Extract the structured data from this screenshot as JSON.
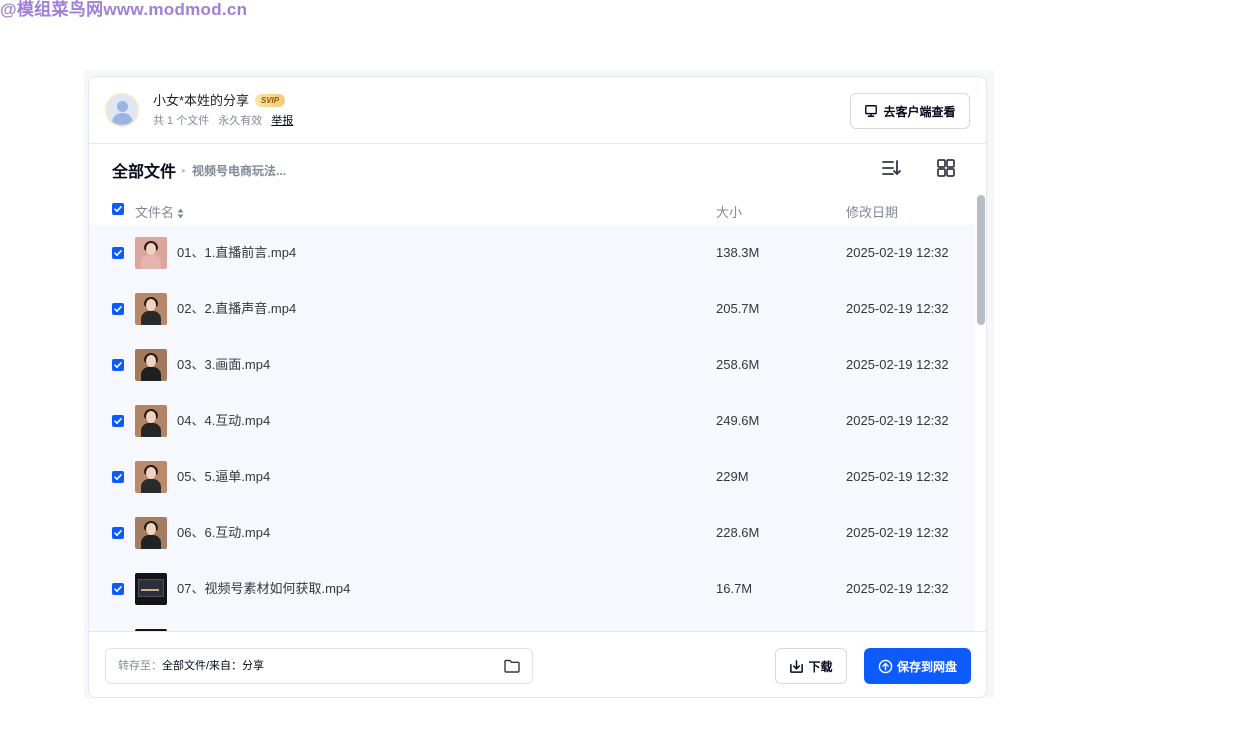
{
  "watermark": "@模组菜鸟网www.modmod.cn",
  "header": {
    "share_title": "小女*本姓的分享",
    "badge": "SVIP",
    "file_count": "共 1 个文件",
    "validity": "永久有效",
    "report": "举报",
    "client_button": "去客户端查看"
  },
  "breadcrumb": {
    "root": "全部文件",
    "separator": "▸",
    "current": "视频号电商玩法..."
  },
  "toolbar": {
    "sort_icon": "sort-list-icon",
    "grid_icon": "grid-view-icon"
  },
  "columns": {
    "name": "文件名",
    "size": "大小",
    "date": "修改日期"
  },
  "files": [
    {
      "name": "01、1.直播前言.mp4",
      "size": "138.3M",
      "date": "2025-02-19 12:32",
      "checked": true
    },
    {
      "name": "02、2.直播声音.mp4",
      "size": "205.7M",
      "date": "2025-02-19 12:32",
      "checked": true
    },
    {
      "name": "03、3.画面.mp4",
      "size": "258.6M",
      "date": "2025-02-19 12:32",
      "checked": true
    },
    {
      "name": "04、4.互动.mp4",
      "size": "249.6M",
      "date": "2025-02-19 12:32",
      "checked": true
    },
    {
      "name": "05、5.逼单.mp4",
      "size": "229M",
      "date": "2025-02-19 12:32",
      "checked": true
    },
    {
      "name": "06、6.互动.mp4",
      "size": "228.6M",
      "date": "2025-02-19 12:32",
      "checked": true
    },
    {
      "name": "07、视频号素材如何获取.mp4",
      "size": "16.7M",
      "date": "2025-02-19 12:32",
      "checked": true
    }
  ],
  "footer": {
    "dest_label": "转存至：",
    "dest_value": "全部文件/来自：分享",
    "download": "下载",
    "save": "保存到网盘"
  },
  "colors": {
    "accent": "#0d5bff",
    "row_bg": "#f6f8fd",
    "muted_text": "#818999"
  }
}
